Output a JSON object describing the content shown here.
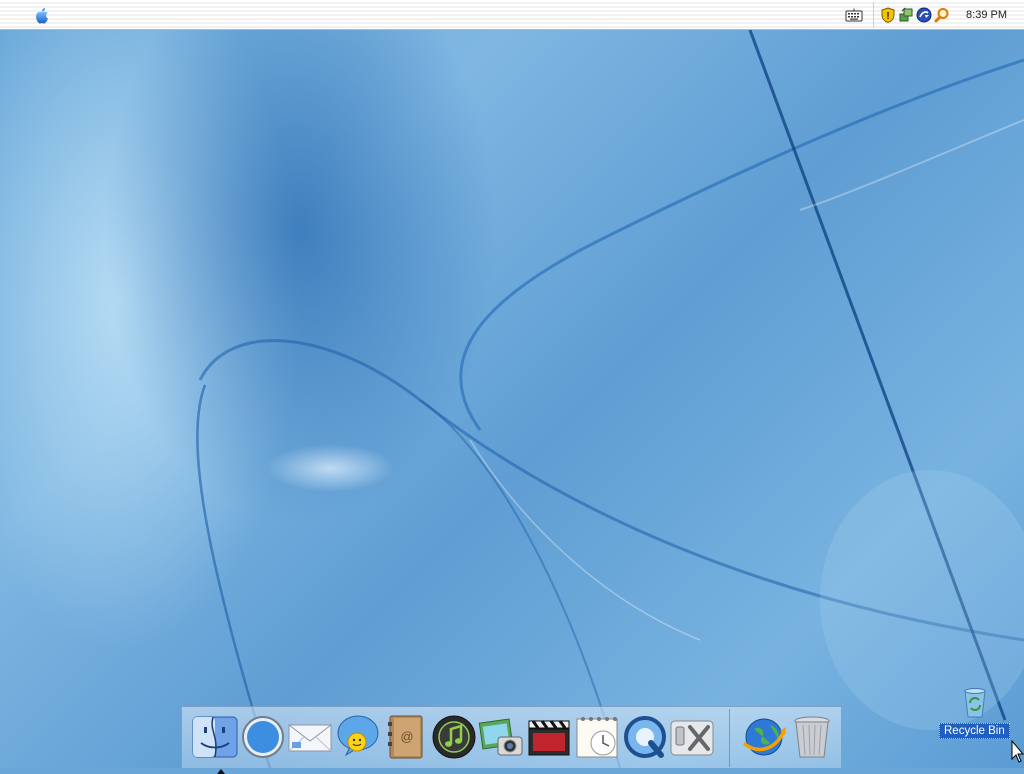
{
  "menubar": {
    "apple_menu_icon": "apple-logo-icon",
    "keyboard_icon": "keyboard-icon",
    "tray_icons": [
      "security-shield-icon",
      "network-icon",
      "update-icon",
      "search-icon"
    ],
    "clock": "8:39 PM"
  },
  "dock": {
    "items": [
      {
        "icon": "finder-icon",
        "running": true
      },
      {
        "icon": "safari-compass-icon"
      },
      {
        "icon": "mail-envelope-icon"
      },
      {
        "icon": "ichat-icon"
      },
      {
        "icon": "address-book-icon"
      },
      {
        "icon": "itunes-icon"
      },
      {
        "icon": "iphoto-icon"
      },
      {
        "icon": "imovie-clapper-icon"
      },
      {
        "icon": "ical-calendar-icon"
      },
      {
        "icon": "quicktime-icon"
      },
      {
        "icon": "system-preferences-icon"
      },
      {
        "icon": "internet-globe-icon"
      },
      {
        "icon": "trash-icon"
      }
    ]
  },
  "desktop_icons": [
    {
      "label": "Recycle Bin",
      "icon": "recycle-bin-icon",
      "selected": true
    }
  ],
  "colors": {
    "desktop_blue": "#6aa6d8",
    "selection_blue": "#1f5fbf"
  }
}
